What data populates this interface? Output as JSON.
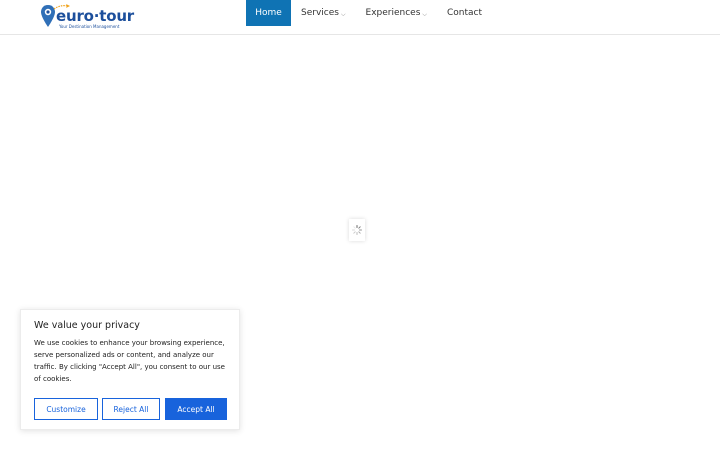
{
  "header": {
    "logo_text": "euro·tour",
    "logo_subtext": "Your Destination Management",
    "nav": [
      {
        "label": "Home",
        "active": true
      },
      {
        "label": "Services",
        "has_dropdown": true
      },
      {
        "label": "Experiences",
        "has_dropdown": true
      },
      {
        "label": "Contact"
      }
    ]
  },
  "cookie_banner": {
    "title": "We value your privacy",
    "text": "We use cookies to enhance your browsing experience, serve personalized ads or content, and analyze our traffic. By clicking \"Accept All\", you consent to our use of cookies.",
    "customize_label": "Customize",
    "reject_label": "Reject All",
    "accept_label": "Accept All"
  },
  "colors": {
    "brand": "#1c4f9c",
    "nav_active": "#0f73b4",
    "button_primary": "#1863dc",
    "logo_pin": "#2f6fb7",
    "logo_plane": "#f0a21a"
  },
  "icons": {
    "logo": "map-pin-plane-icon",
    "loader": "spinner-icon",
    "nav_dropdown": "chevron-down-icon"
  }
}
